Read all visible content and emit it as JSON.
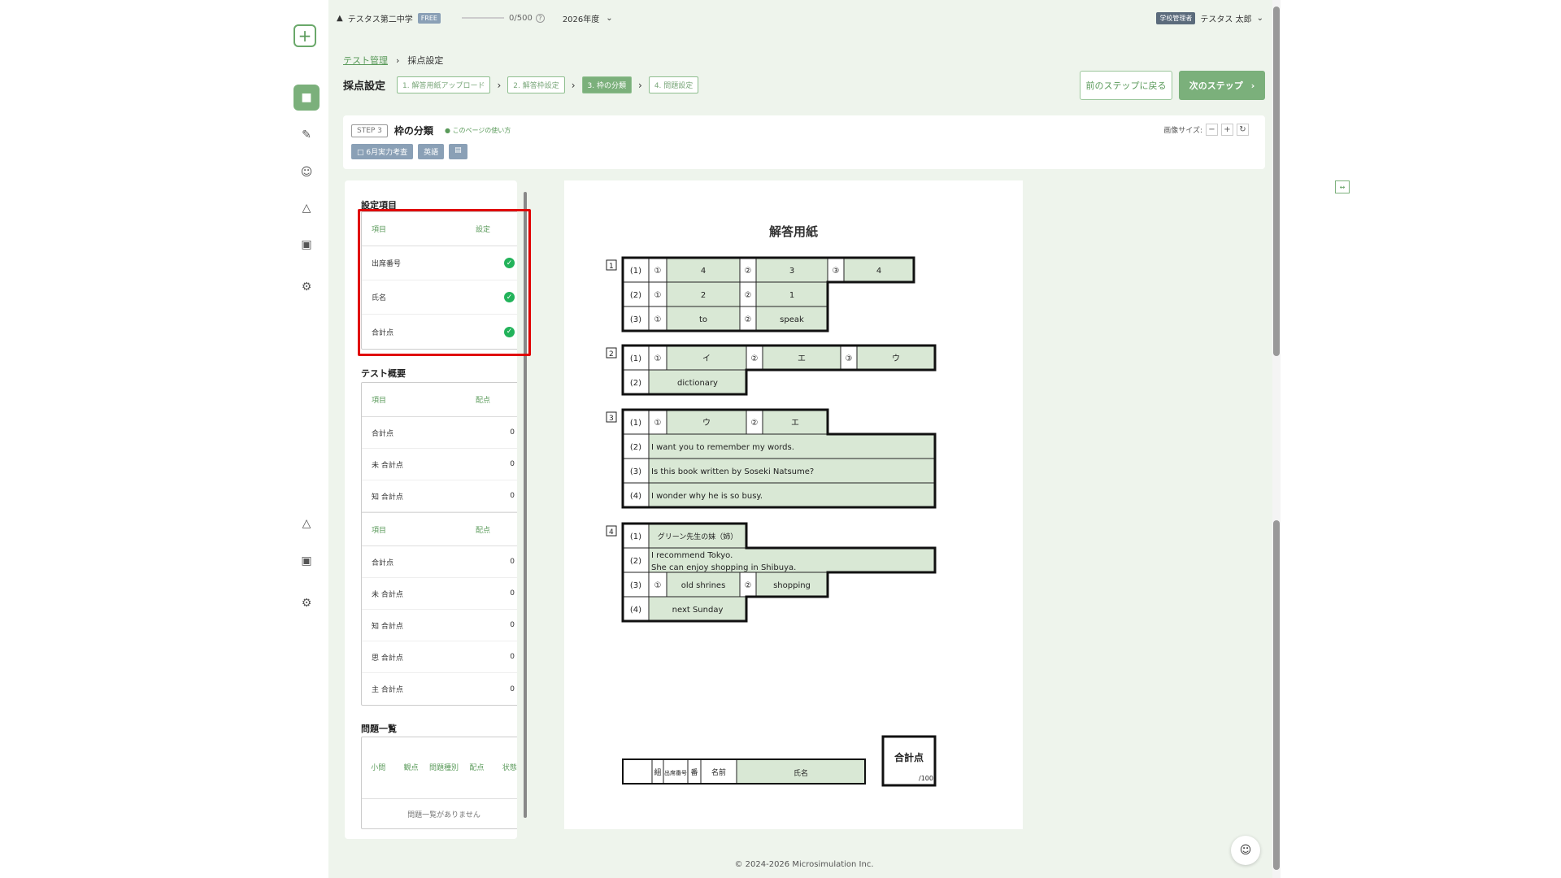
{
  "topbar": {
    "school": "テスタス第二中学",
    "plan": "FREE",
    "usage": "0/500",
    "year": "2026年度",
    "role": "学校管理者",
    "user": "テスタス 太郎"
  },
  "breadcrumb": {
    "parent": "テスト管理",
    "current": "採点設定"
  },
  "steps": {
    "title": "採点設定",
    "items": [
      "1. 解答用紙アップロード",
      "2. 解答枠設定",
      "3. 枠の分類",
      "4. 問題設定"
    ]
  },
  "buttons": {
    "prev": "前のステップに戻る",
    "next": "次のステップ"
  },
  "step_panel": {
    "step": "STEP 3",
    "title": "枠の分類",
    "help": "このページの使い方",
    "tag_test": "6月実力考査",
    "tag_subject": "英語",
    "zoom_label": "画像サイズ:"
  },
  "settings": {
    "heading": "設定項目",
    "col_item": "項目",
    "col_setting": "設定",
    "rows": [
      "出席番号",
      "氏名",
      "合計点"
    ]
  },
  "overview": {
    "heading": "テスト概要",
    "col_item": "項目",
    "col_points": "配点",
    "group1": [
      [
        "合計点",
        "0"
      ],
      [
        "未 合計点",
        "0"
      ],
      [
        "知 合計点",
        "0"
      ]
    ],
    "group2": [
      [
        "合計点",
        "0"
      ],
      [
        "未 合計点",
        "0"
      ],
      [
        "知 合計点",
        "0"
      ],
      [
        "思 合計点",
        "0"
      ],
      [
        "主 合計点",
        "0"
      ]
    ]
  },
  "questions": {
    "heading": "問題一覧",
    "cols": [
      "小問",
      "観点",
      "問題種別",
      "配点",
      "状態"
    ],
    "empty": "問題一覧がありません"
  },
  "sheet": {
    "title": "解答用紙",
    "q1": {
      "r1": [
        "4",
        "3",
        "4"
      ],
      "r2": [
        "2",
        "1"
      ],
      "r3": [
        "to",
        "speak"
      ]
    },
    "q2": {
      "r1": [
        "イ",
        "エ",
        "ウ"
      ],
      "r2": "dictionary"
    },
    "q3": {
      "r1": [
        "ウ",
        "エ"
      ],
      "r2": "I want you to remember my words.",
      "r3": "Is this book written by Soseki Natsume?",
      "r4": "I wonder why he is so busy."
    },
    "q4": {
      "r1": "グリーン先生の妹（姉）",
      "r2a": "I recommend Tokyo.",
      "r2b": "She can enjoy shopping in Shibuya.",
      "r3": [
        "old shrines",
        "shopping"
      ],
      "r4": "next Sunday"
    },
    "name_row": {
      "kumi": "組",
      "shusseki": "出席番号",
      "ban": "番",
      "namae": "名前",
      "shimei": "氏名"
    },
    "total": {
      "label": "合計点",
      "max": "/100"
    }
  },
  "footer": "© 2024-2026 Microsimulation Inc."
}
